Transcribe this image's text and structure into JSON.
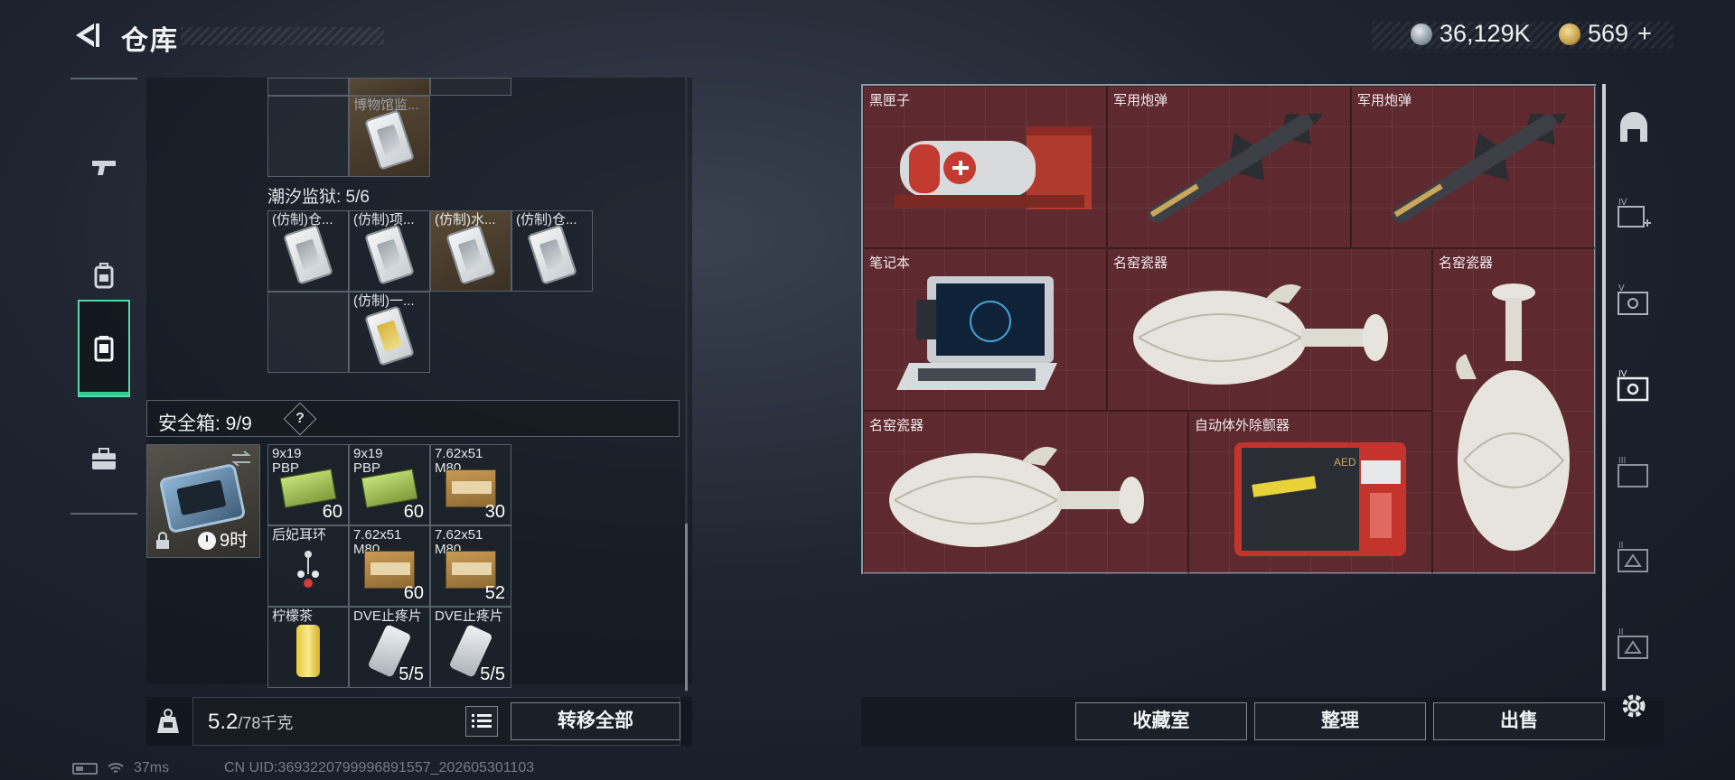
{
  "header": {
    "title": "仓库"
  },
  "currency": [
    {
      "name": "silver-coin",
      "value": "36,129K"
    },
    {
      "name": "gold-coin",
      "value": "569",
      "suffix": "+"
    }
  ],
  "left_panel": {
    "top_items": [
      {
        "label": "博物馆监..."
      }
    ],
    "prison_label": "潮汐监狱: 5/6",
    "prison_items": [
      {
        "label": "(仿制)仓..."
      },
      {
        "label": "(仿制)项..."
      },
      {
        "label": "(仿制)水..."
      },
      {
        "label": "(仿制)仓..."
      },
      {
        "label": "(仿制)一..."
      }
    ],
    "safe_box": {
      "title": "安全箱:  9/9",
      "help": "?",
      "timer": "9时"
    },
    "safe_items": [
      {
        "label": "9x19 PBP",
        "count": "60"
      },
      {
        "label": "9x19 PBP",
        "count": "60"
      },
      {
        "label": "7.62x51 M80",
        "count": "30"
      },
      {
        "label": "后妃耳环",
        "count": ""
      },
      {
        "label": "7.62x51 M80",
        "count": "60"
      },
      {
        "label": "7.62x51 M80",
        "count": "52"
      },
      {
        "label": "柠檬茶",
        "count": ""
      },
      {
        "label": "DVE止疼片",
        "count": "5/5"
      },
      {
        "label": "DVE止疼片",
        "count": "5/5"
      }
    ],
    "weight": {
      "current": "5.2",
      "max": "/78千克"
    },
    "transfer_label": "转移全部"
  },
  "storage": {
    "items": [
      {
        "label": "黑匣子"
      },
      {
        "label": "军用炮弹"
      },
      {
        "label": "军用炮弹"
      },
      {
        "label": "笔记本"
      },
      {
        "label": "名窑瓷器"
      },
      {
        "label": "名窑瓷器"
      },
      {
        "label": "名窑瓷器"
      },
      {
        "label": "自动体外除颤器"
      }
    ],
    "aed_text": "AED"
  },
  "right_sidebar": [
    "home-icon",
    "tier-iv-add-icon",
    "tier-v-icon",
    "tier-iv-icon",
    "tier-iii-icon",
    "tier-ii-icon",
    "tier-ii-b-icon"
  ],
  "buttons": {
    "collection": "收藏室",
    "organize": "整理",
    "sell": "出售"
  },
  "status": {
    "ping": "37ms",
    "uid": "CN UID:3693220799996891557_202605301103"
  },
  "colors": {
    "storage_bg": "#5e2a30",
    "active_tab": "#5fd3a7"
  }
}
